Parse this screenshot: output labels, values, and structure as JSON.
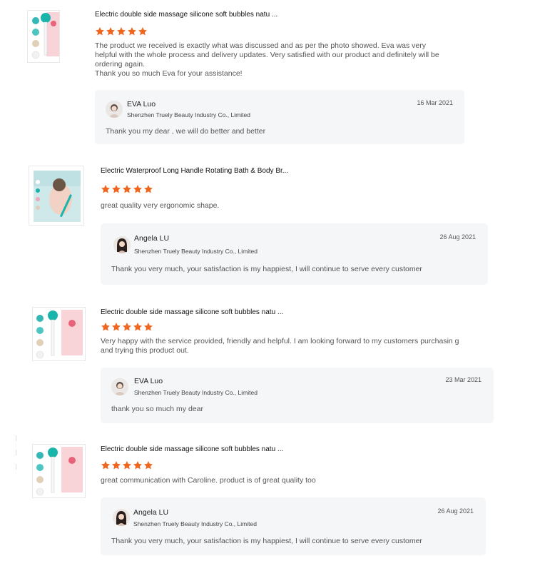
{
  "reviews": [
    {
      "product_title": "Electric double side massage silicone soft bubbles natu ...",
      "rating": 5,
      "text": "The product we received is exactly what was discussed and as per the photo showed. Eva was very helpful with the whole process and delivery updates. Very satisfied with our product and definitely will be ordering again.",
      "text2": "Thank you so much Eva for your assistance!",
      "reply": {
        "name": "EVA Luo",
        "company": "Shenzhen Truely Beauty Industry Co., Limited",
        "date": "16 Mar 2021",
        "text": "Thank  you  my dear , we will do better and better"
      }
    },
    {
      "product_title": "Electric Waterproof Long Handle Rotating Bath & Body Br...",
      "rating": 5,
      "text": "great quality very ergonomic shape.",
      "text2": "",
      "reply": {
        "name": "Angela LU",
        "company": "Shenzhen Truely Beauty Industry Co., Limited",
        "date": "26 Aug 2021",
        "text": "Thank you very much, your satisfaction is my happiest, I will continue to serve every customer"
      }
    },
    {
      "product_title": "Electric double side massage silicone soft bubbles natu ...",
      "rating": 5,
      "text": "Very happy with the service provided, friendly and helpful. I am looking forward to my customers purchasin g and trying this product out.",
      "text2": "",
      "reply": {
        "name": "EVA Luo",
        "company": "Shenzhen Truely Beauty Industry Co., Limited",
        "date": "23 Mar 2021",
        "text": "thank you so much my dear"
      }
    },
    {
      "product_title": "Electric double side massage silicone soft bubbles natu ...",
      "rating": 5,
      "text": "great communication with Caroline. product is of great quality too",
      "text2": "",
      "reply": {
        "name": "Angela LU",
        "company": "Shenzhen Truely Beauty Industry Co., Limited",
        "date": "26 Aug 2021",
        "text": "Thank you very much, your satisfaction is my happiest, I will continue to serve every customer"
      }
    }
  ],
  "colors": {
    "star": "#f0661f",
    "reply_bg": "#f5f6f8"
  },
  "icons": {
    "star": "star-icon",
    "product_thumb_brush": "bath-brush-product-image",
    "product_thumb_photo": "bath-photo-product-image"
  }
}
